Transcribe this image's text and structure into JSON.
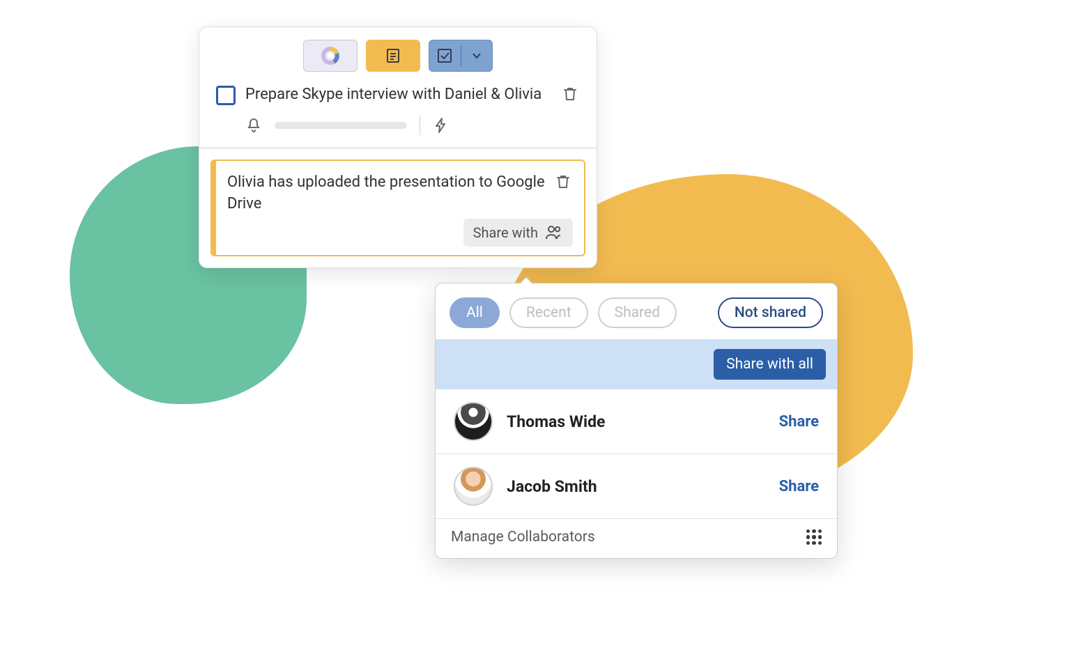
{
  "task": {
    "title": "Prepare Skype interview with Daniel & Olivia"
  },
  "note": {
    "text": "Olivia has uploaded the presentation to Google Drive",
    "share_with_label": "Share with"
  },
  "share": {
    "filters": {
      "all": "All",
      "recent": "Recent",
      "shared": "Shared",
      "not_shared": "Not shared"
    },
    "share_all_label": "Share with all",
    "people": [
      {
        "name": "Thomas Wide",
        "action": "Share"
      },
      {
        "name": "Jacob Smith",
        "action": "Share"
      }
    ],
    "manage_label": "Manage Collaborators"
  }
}
